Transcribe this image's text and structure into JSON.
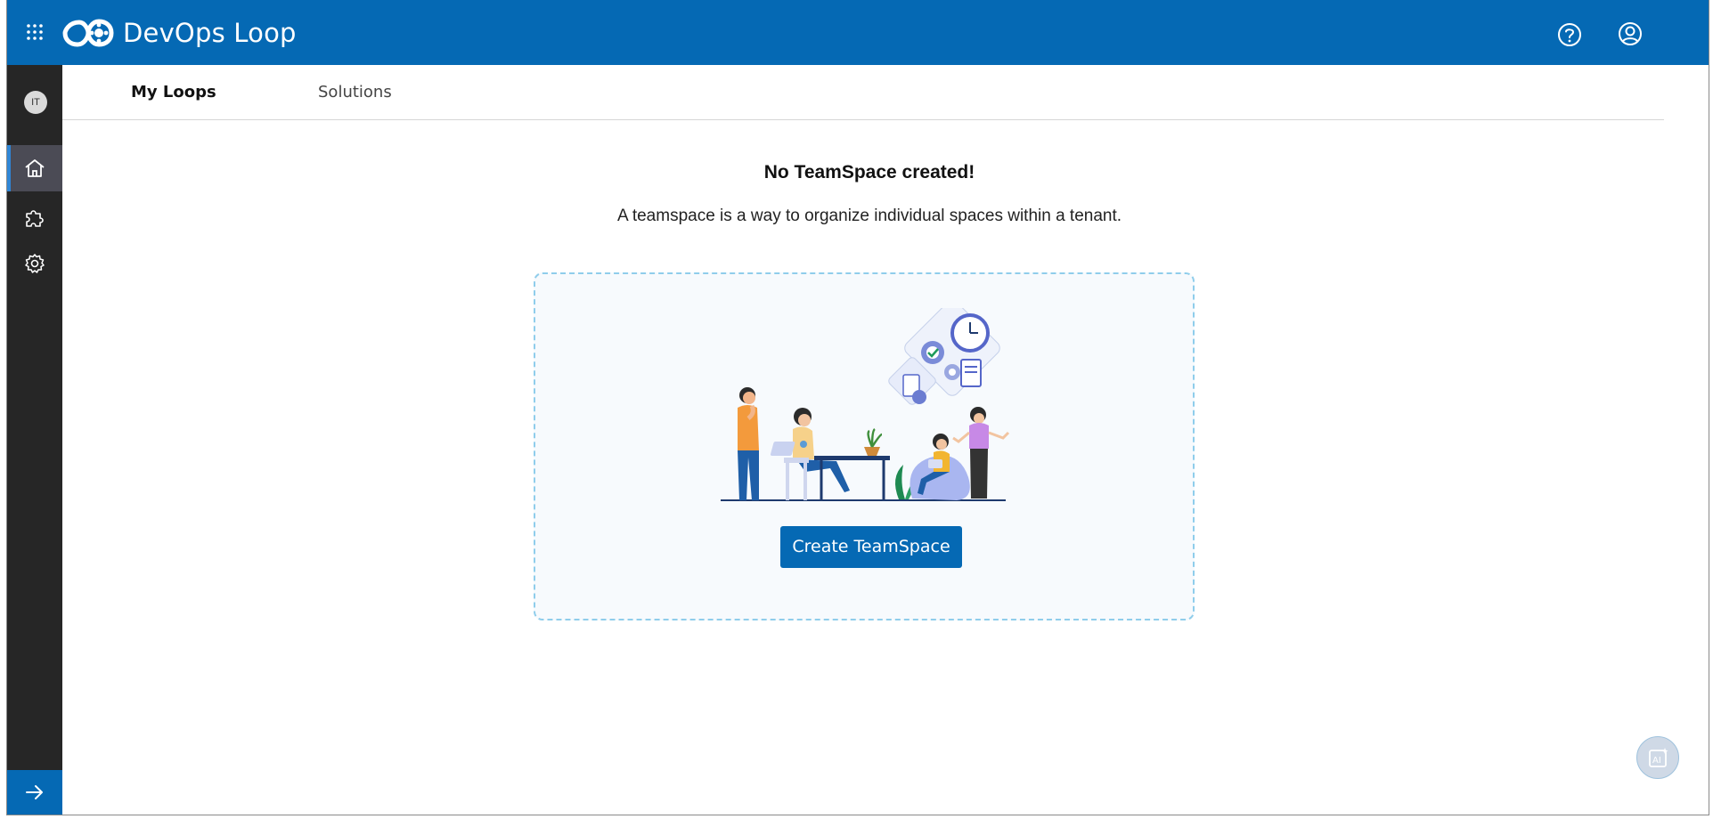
{
  "app": {
    "title": "DevOps Loop"
  },
  "header": {
    "icons": [
      "app-grid-icon",
      "devops-loop-logo",
      "help-icon",
      "user-profile-icon"
    ]
  },
  "sidebar": {
    "avatar_initials": "IT",
    "items": [
      {
        "name": "home",
        "icon": "home-icon",
        "active": true
      },
      {
        "name": "integrations",
        "icon": "puzzle-icon",
        "active": false
      },
      {
        "name": "settings",
        "icon": "gear-icon",
        "active": false
      }
    ],
    "collapse_icon": "arrow-right-icon"
  },
  "tabs": [
    {
      "label": "My Loops",
      "active": true
    },
    {
      "label": "Solutions",
      "active": false
    }
  ],
  "empty_state": {
    "title": "No TeamSpace created!",
    "description": "A teamspace is a way to organize individual spaces within a tenant.",
    "button_label": "Create TeamSpace"
  },
  "floating": {
    "ai_icon": "ai-assistant-icon"
  },
  "colors": {
    "brand_blue": "#0569b4",
    "sidebar_dark": "#262626",
    "dropzone_border": "#8fcdeb"
  }
}
